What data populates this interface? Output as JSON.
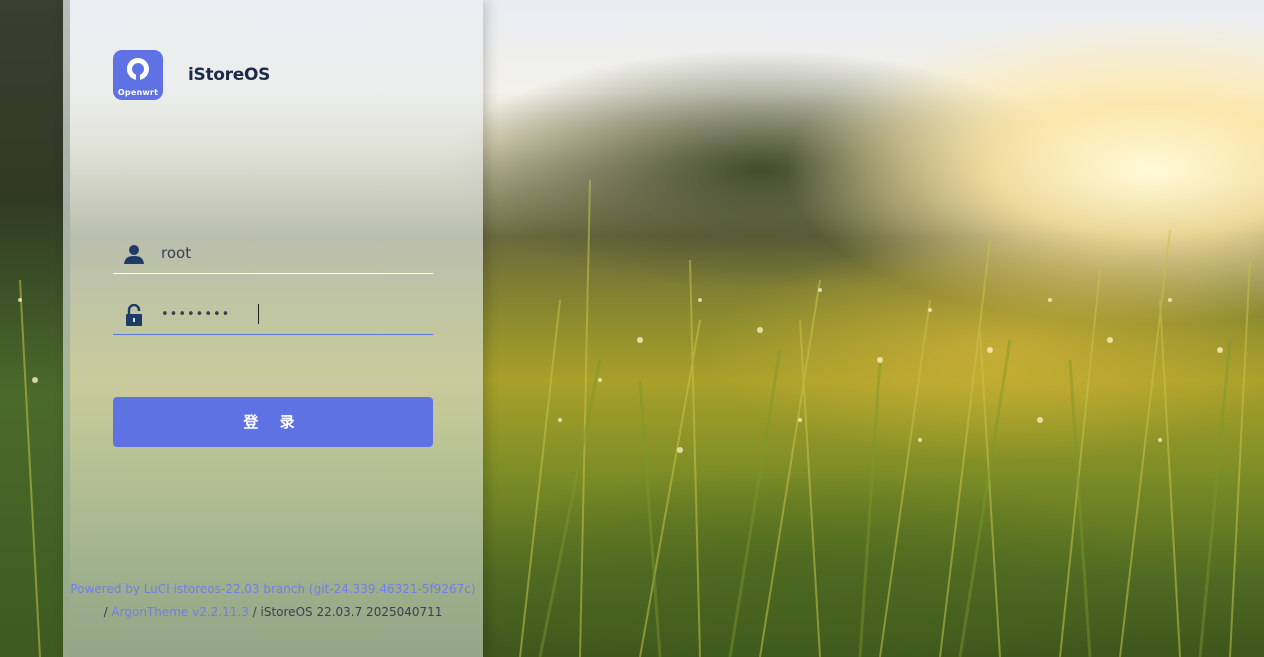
{
  "brand": {
    "logo_sub_label": "Openwrt",
    "title": "iStoreOS"
  },
  "form": {
    "username_value": "root",
    "password_value": "••••••••",
    "login_label": "登 录"
  },
  "footer": {
    "powered_by_link": "Powered by LuCI istoreos-22.03 branch (git-24.339.46321-5f9267c)",
    "separator1": "/ ",
    "theme_link": "ArgonTheme v2.2.11.3",
    "build_text": " / iStoreOS 22.03.7 2025040711"
  },
  "colors": {
    "accent": "#5e72e4",
    "brand_text": "#1e2a4a",
    "link": "#6f7fe8"
  },
  "icons": {
    "user": "user-icon",
    "lock": "unlock-icon",
    "logo": "openwrt-logo-icon"
  }
}
